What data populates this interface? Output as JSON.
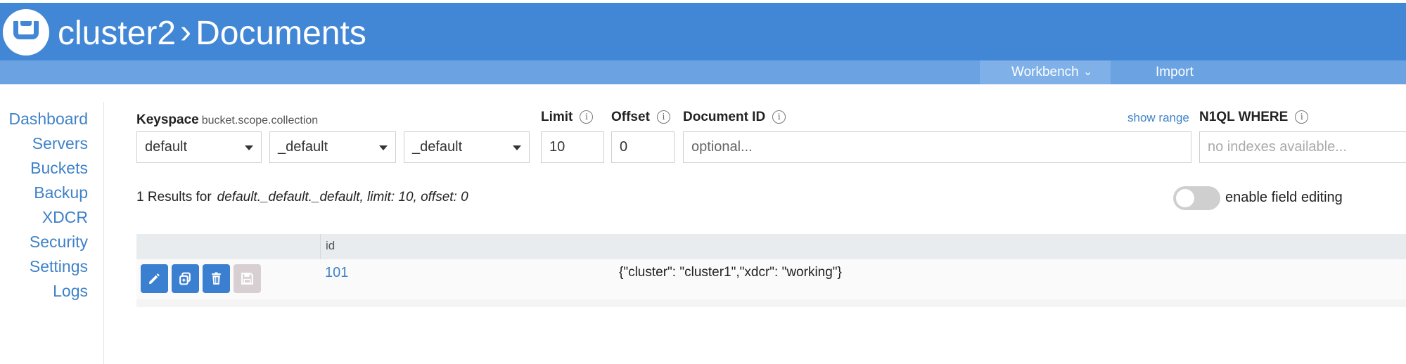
{
  "header": {
    "cluster": "cluster2",
    "separator": "›",
    "section": "Documents"
  },
  "subnav": {
    "workbench": "Workbench",
    "workbench_chevron": "⌄",
    "import": "Import"
  },
  "sidebar": {
    "items": [
      {
        "label": "Dashboard"
      },
      {
        "label": "Servers"
      },
      {
        "label": "Buckets"
      },
      {
        "label": "Backup"
      },
      {
        "label": "XDCR"
      },
      {
        "label": "Security"
      },
      {
        "label": "Settings"
      },
      {
        "label": "Logs"
      }
    ]
  },
  "filters": {
    "keyspace_label": "Keyspace",
    "keyspace_hint": "bucket.scope.collection",
    "bucket": "default",
    "scope": "_default",
    "collection": "_default",
    "limit_label": "Limit",
    "limit_value": "10",
    "offset_label": "Offset",
    "offset_value": "0",
    "docid_label": "Document ID",
    "docid_placeholder": "optional...",
    "show_range": "show range",
    "where_label": "N1QL WHERE",
    "where_placeholder": "no indexes available...",
    "info_glyph": "i"
  },
  "results": {
    "prefix": "1 Results for",
    "query": "default._default._default, limit: 10, offset: 0"
  },
  "field_editing": {
    "label": "enable field editing",
    "enabled": false
  },
  "table": {
    "columns": [
      "id"
    ],
    "rows": [
      {
        "id": "101",
        "value": "{\"cluster\": \"cluster1\",\"xdcr\": \"working\"}"
      }
    ]
  },
  "icons": {
    "logo": "couchbase-logo-icon",
    "row_actions": [
      "edit-icon",
      "copy-icon",
      "delete-icon",
      "save-icon"
    ]
  },
  "colors": {
    "header_bg": "#4287d6",
    "subnav_bg": "#6aa2e2",
    "link": "#3f82c8",
    "action_button": "#3b7fd0",
    "disabled_button": "#d8cfd3"
  }
}
